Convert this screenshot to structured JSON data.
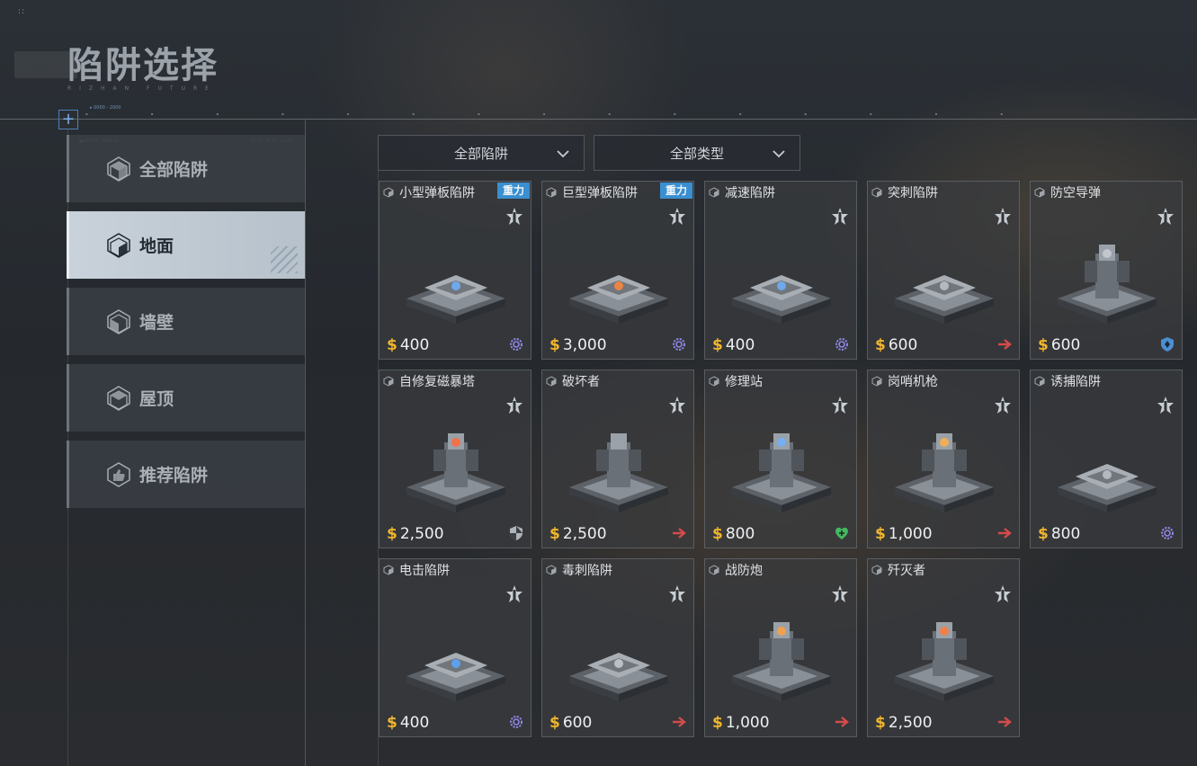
{
  "header": {
    "dots": "::",
    "title": "陷阱选择",
    "subtitle": "RIZHAN FUTURE",
    "small_tag": "▸ 0000 - 2000"
  },
  "sidebar": {
    "deco_left": "▮▮ SECTOR · CATALOG",
    "deco_right": "117 11 · 22 10 · 13 100",
    "items": [
      {
        "label": "全部陷阱",
        "icon": "cube-icon",
        "active": false
      },
      {
        "label": "地面",
        "icon": "cube-floor-icon",
        "active": true
      },
      {
        "label": "墙壁",
        "icon": "cube-wall-icon",
        "active": false
      },
      {
        "label": "屋顶",
        "icon": "cube-roof-icon",
        "active": false
      },
      {
        "label": "推荐陷阱",
        "icon": "thumbs-up-icon",
        "active": false
      }
    ]
  },
  "filters": {
    "trap_filter": "全部陷阱",
    "type_filter": "全部类型"
  },
  "colors": {
    "accent_blue": "#3a8fd0",
    "currency_gold": "#f0b52e",
    "gear_purple": "#8f86e6",
    "arrow_red": "#d44b4b",
    "heal_green": "#45b860",
    "active_tab": "#c9d2da"
  },
  "traps": [
    {
      "name": "小型弹板陷阱",
      "badge": "重力",
      "price": "400",
      "type_icon": "gear-icon"
    },
    {
      "name": "巨型弹板陷阱",
      "badge": "重力",
      "price": "3,000",
      "type_icon": "gear-icon"
    },
    {
      "name": "减速陷阱",
      "badge": "",
      "price": "400",
      "type_icon": "gear-icon"
    },
    {
      "name": "突刺陷阱",
      "badge": "",
      "price": "600",
      "type_icon": "arrow-icon"
    },
    {
      "name": "防空导弹",
      "badge": "",
      "price": "600",
      "type_icon": "shield-blue-icon"
    },
    {
      "name": "自修复磁暴塔",
      "badge": "",
      "price": "2,500",
      "type_icon": "shield-icon"
    },
    {
      "name": "破坏者",
      "badge": "",
      "price": "2,500",
      "type_icon": "arrow-icon"
    },
    {
      "name": "修理站",
      "badge": "",
      "price": "800",
      "type_icon": "heal-icon"
    },
    {
      "name": "岗哨机枪",
      "badge": "",
      "price": "1,000",
      "type_icon": "arrow-icon"
    },
    {
      "name": "诱捕陷阱",
      "badge": "",
      "price": "800",
      "type_icon": "gear-icon"
    },
    {
      "name": "电击陷阱",
      "badge": "",
      "price": "400",
      "type_icon": "gear-icon"
    },
    {
      "name": "毒刺陷阱",
      "badge": "",
      "price": "600",
      "type_icon": "arrow-icon"
    },
    {
      "name": "战防炮",
      "badge": "",
      "price": "1,000",
      "type_icon": "arrow-icon"
    },
    {
      "name": "歼灭者",
      "badge": "",
      "price": "2,500",
      "type_icon": "arrow-icon"
    }
  ],
  "currency_symbol": "$"
}
